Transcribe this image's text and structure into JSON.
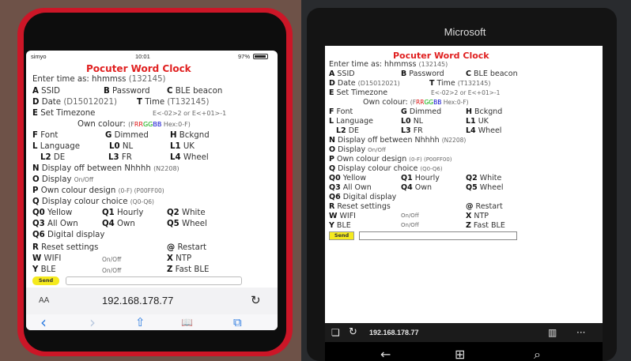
{
  "left_phone": {
    "status": {
      "carrier": "simyo",
      "time": "10:01",
      "battery": "97%"
    },
    "page": {
      "title": "Pocuter Word Clock",
      "enter_time": "Enter time as: hhmmss",
      "enter_time_example": "(132145)",
      "menu": {
        "a": {
          "key": "A",
          "label": "SSID"
        },
        "b": {
          "key": "B",
          "label": "Password"
        },
        "c": {
          "key": "C",
          "label": "BLE beacon"
        },
        "d": {
          "key": "D",
          "label": "Date",
          "hint": "(D15012021)"
        },
        "t": {
          "key": "T",
          "label": "Time",
          "hint": "(T132145)"
        },
        "e": {
          "key": "E",
          "label": "Set Timezone",
          "hint": "E<-02>2 or E<+01>-1"
        },
        "own_colour": {
          "label": "Own colour:",
          "hint_prefix": "(F",
          "rr": "RR",
          "gg": "GG",
          "bb": "BB",
          "hint_suffix": " Hex:0-F)"
        },
        "f": {
          "key": "F",
          "label": "Font"
        },
        "g": {
          "key": "G",
          "label": "Dimmed"
        },
        "h": {
          "key": "H",
          "label": "Bckgnd"
        },
        "l": {
          "key": "L",
          "label": "Language"
        },
        "l0": {
          "key": "L0",
          "label": "NL"
        },
        "l1": {
          "key": "L1",
          "label": "UK"
        },
        "l2": {
          "key": "L2",
          "label": "DE"
        },
        "l3": {
          "key": "L3",
          "label": "FR"
        },
        "l4": {
          "key": "L4",
          "label": "Wheel"
        },
        "n": {
          "key": "N",
          "label": "Display off between Nhhhh",
          "hint": "(N2208)"
        },
        "o": {
          "key": "O",
          "label": "Display",
          "hint": "On/Off"
        },
        "p": {
          "key": "P",
          "label": "Own colour design",
          "hint": "(0-F)  (P00FF00)"
        },
        "q": {
          "key": "Q",
          "label": "Display colour choice",
          "hint": "(Q0-Q6)"
        },
        "q0": {
          "key": "Q0",
          "label": "Yellow"
        },
        "q1": {
          "key": "Q1",
          "label": "Hourly"
        },
        "q2": {
          "key": "Q2",
          "label": "White"
        },
        "q3": {
          "key": "Q3",
          "label": "All Own"
        },
        "q4": {
          "key": "Q4",
          "label": "Own"
        },
        "q5": {
          "key": "Q5",
          "label": "Wheel"
        },
        "q6": {
          "key": "Q6",
          "label": "Digital display"
        },
        "r": {
          "key": "R",
          "label": "Reset settings"
        },
        "at": {
          "key": "@",
          "label": "Restart"
        },
        "w": {
          "key": "W",
          "label": "WIFI",
          "hint": "On/Off"
        },
        "x": {
          "key": "X",
          "label": "NTP"
        },
        "y": {
          "key": "Y",
          "label": "BLE",
          "hint": "On/Off"
        },
        "z": {
          "key": "Z",
          "label": "Fast BLE"
        }
      },
      "send_label": "Send",
      "input_value": ""
    },
    "browser": {
      "aa": "AA",
      "url": "192.168.178.77",
      "reload": "↻",
      "back": "‹",
      "forward": "›",
      "share": "⇧",
      "bookmarks": "📖",
      "tabs": "⧉"
    }
  },
  "right_phone": {
    "brand": "Microsoft",
    "browser": {
      "tabs_icon": "❏",
      "refresh": "↻",
      "url": "192.168.178.77",
      "reading": "▥",
      "more": "···"
    },
    "nav": {
      "back": "←",
      "windows": "⊞",
      "search": "⌕"
    },
    "send_label": "Send"
  }
}
